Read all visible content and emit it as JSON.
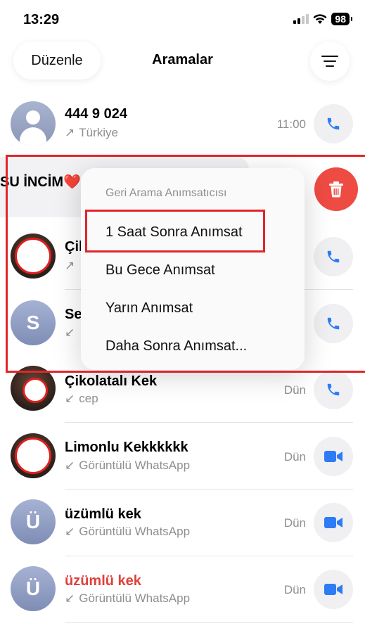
{
  "status": {
    "time": "13:29",
    "battery": "98"
  },
  "header": {
    "edit_label": "Düzenle",
    "title": "Aramalar"
  },
  "calls": [
    {
      "name": "444 9 024",
      "detail": "Türkiye",
      "direction": "outgoing",
      "time": "11:00",
      "action": "phone-icon"
    },
    {
      "name": "SU İNCİM❤️",
      "action": "trash-icon"
    },
    {
      "name": "Çil",
      "detail": "",
      "direction": "outgoing",
      "action": "phone-icon"
    },
    {
      "name": "Se",
      "initial": "S",
      "detail": "",
      "direction": "incoming",
      "action": "phone-icon"
    },
    {
      "name": "Çikolatalı Kek",
      "detail": "cep",
      "direction": "incoming",
      "time": "Dün",
      "action": "phone-icon"
    },
    {
      "name": "Limonlu Kekkkkkk",
      "detail": "Görüntülü WhatsApp",
      "direction": "incoming",
      "time": "Dün",
      "action": "video-icon"
    },
    {
      "name": "üzümlü kek",
      "initial": "Ü",
      "detail": "Görüntülü WhatsApp",
      "direction": "incoming",
      "time": "Dün",
      "action": "video-icon"
    },
    {
      "name": "üzümlü kek",
      "initial": "Ü",
      "detail": "Görüntülü WhatsApp",
      "direction": "incoming",
      "time": "Dün",
      "action": "video-icon",
      "missed": true
    }
  ],
  "menu": {
    "title": "Geri Arama Anımsatıcısı",
    "items": [
      "1 Saat Sonra Anımsat",
      "Bu Gece Anımsat",
      "Yarın Anımsat",
      "Daha Sonra Anımsat..."
    ]
  },
  "colors": {
    "accent": "#2d7cf6",
    "delete": "#ee4b43",
    "missed": "#e0413a",
    "annotation": "#e0262b"
  }
}
